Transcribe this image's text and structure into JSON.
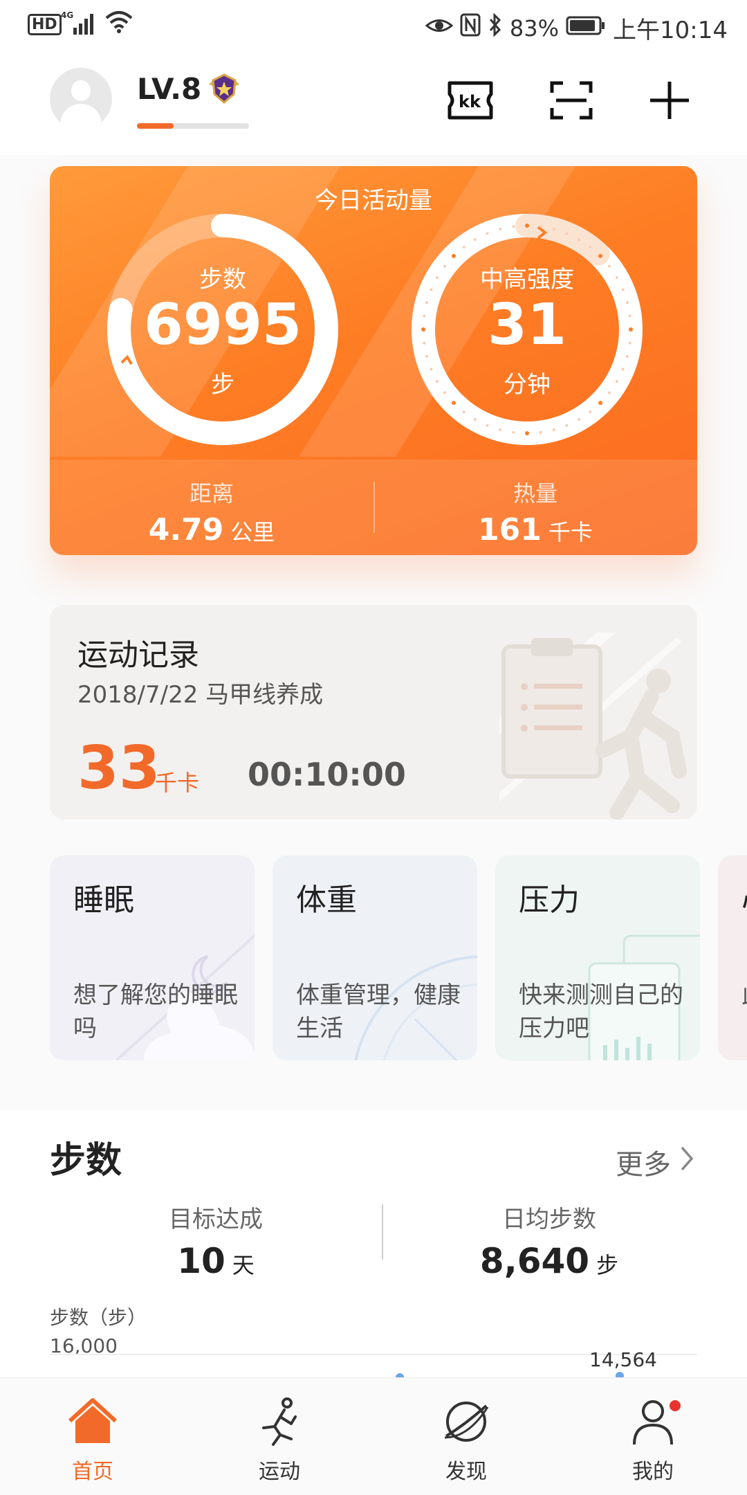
{
  "status_bar": {
    "hd": "HD",
    "network": "4G",
    "battery_percent": "83%",
    "time": "上午10:14"
  },
  "header": {
    "level": "LV.8",
    "level_progress": 0.33
  },
  "activity": {
    "title": "今日活动量",
    "steps_label": "步数",
    "steps_value": "6995",
    "steps_unit": "步",
    "steps_ring_fill": 0.78,
    "intensity_label": "中高强度",
    "intensity_value": "31",
    "intensity_unit": "分钟",
    "intensity_ring_fill": 0.12,
    "distance_label": "距离",
    "distance_value": "4.79",
    "distance_unit": "公里",
    "calories_label": "热量",
    "calories_value": "161",
    "calories_unit": "千卡"
  },
  "record": {
    "title": "运动记录",
    "subtitle": "2018/7/22  马甲线养成",
    "kcal_value": "33",
    "kcal_unit": "千卡",
    "duration": "00:10:00"
  },
  "tiles": [
    {
      "title": "睡眠",
      "desc": "想了解您的睡眠吗"
    },
    {
      "title": "体重",
      "desc": "体重管理，健康生活"
    },
    {
      "title": "压力",
      "desc": "快来测测自己的压力吧"
    },
    {
      "title": "心",
      "desc": "此看"
    }
  ],
  "steps_section": {
    "title": "步数",
    "more": "更多",
    "goal_label": "目标达成",
    "goal_value": "10",
    "goal_unit": "天",
    "avg_label": "日均步数",
    "avg_value": "8,640",
    "avg_unit": "步",
    "chart_label": "步数（步）",
    "chart_max": "16,000",
    "chart_peak": "14,564"
  },
  "bottom_nav": [
    {
      "label": "首页",
      "icon": "home-icon",
      "active": true
    },
    {
      "label": "运动",
      "icon": "running-icon",
      "active": false
    },
    {
      "label": "发现",
      "icon": "discover-icon",
      "active": false
    },
    {
      "label": "我的",
      "icon": "profile-icon",
      "active": false
    }
  ],
  "colors": {
    "accent": "#f26a2a",
    "card_orange": "#fe7d24"
  }
}
